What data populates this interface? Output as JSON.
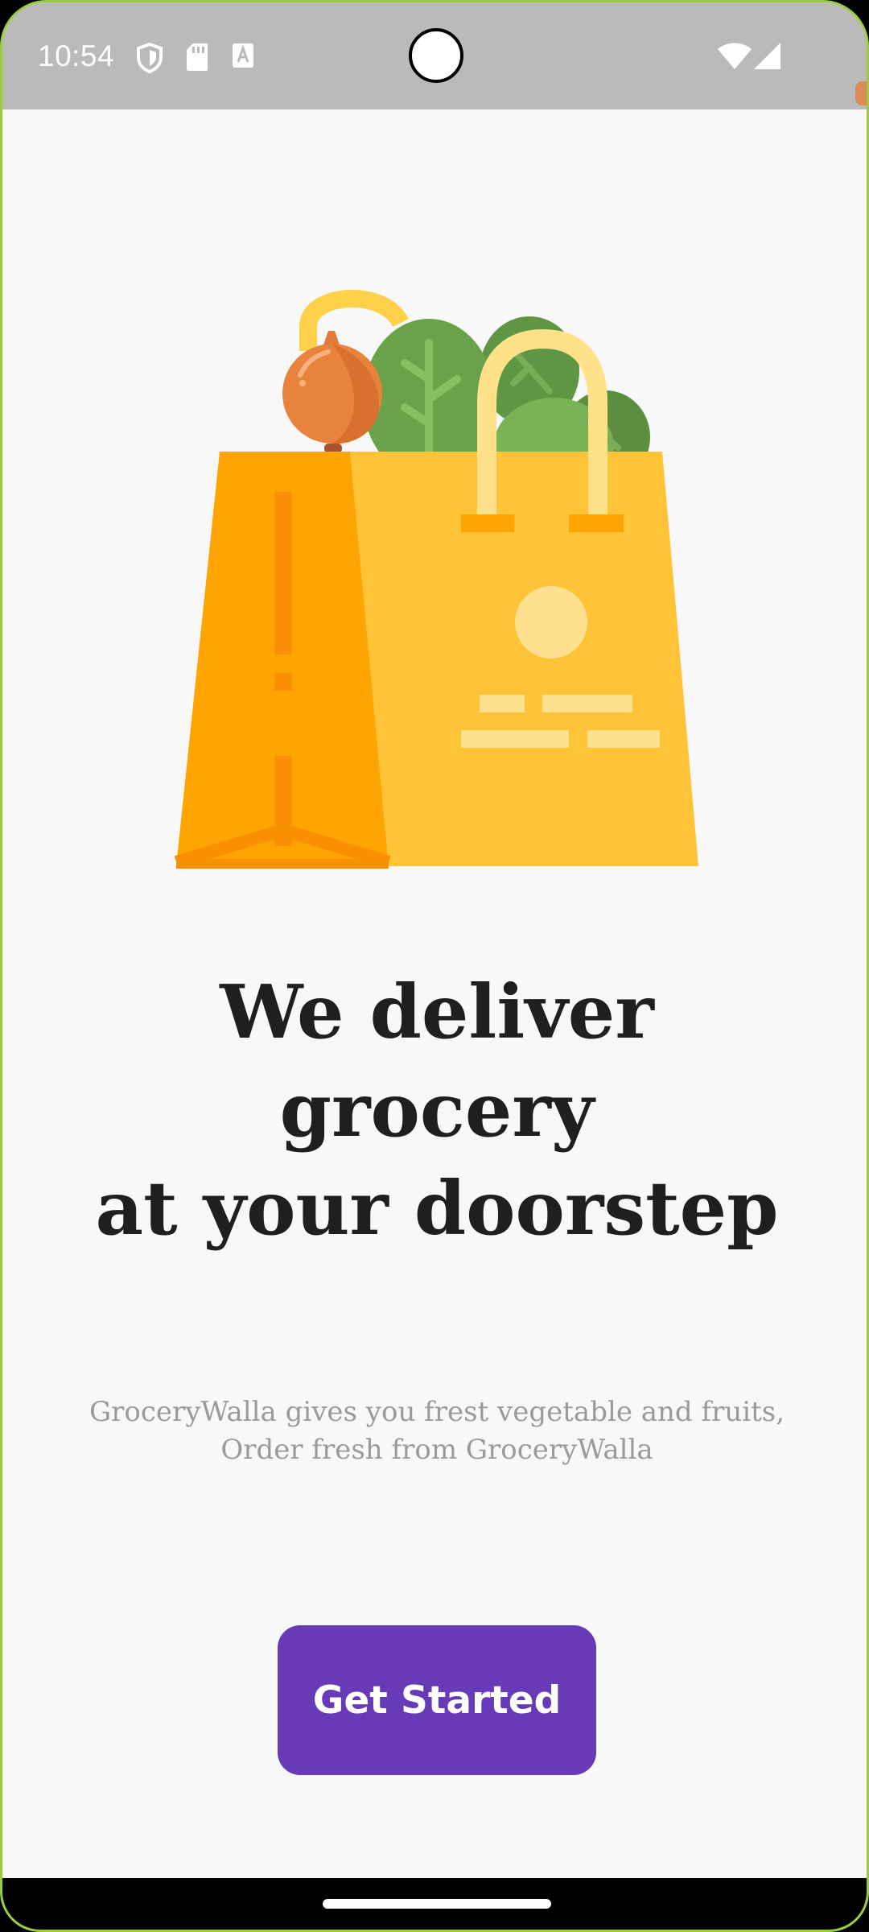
{
  "status_bar": {
    "time": "10:54",
    "icons": [
      "shield-icon",
      "sd-card-icon",
      "font-a-icon",
      "wifi-icon",
      "signal-icon"
    ]
  },
  "onboarding": {
    "illustration": "grocery-bag-illustration",
    "headline": {
      "line1": "We deliver",
      "line2": "grocery",
      "line3": "at your doorstep"
    },
    "subtitle": {
      "line1": "GroceryWalla gives you frest vegetable and fruits,",
      "line2": "Order fresh from GroceryWalla"
    },
    "cta_label": "Get Started"
  },
  "colors": {
    "status_bar": "#bababa",
    "background": "#f8f8f8",
    "accent": "#673ab7",
    "headline": "#1f1f1f",
    "subtitle": "#9a9a9a"
  }
}
